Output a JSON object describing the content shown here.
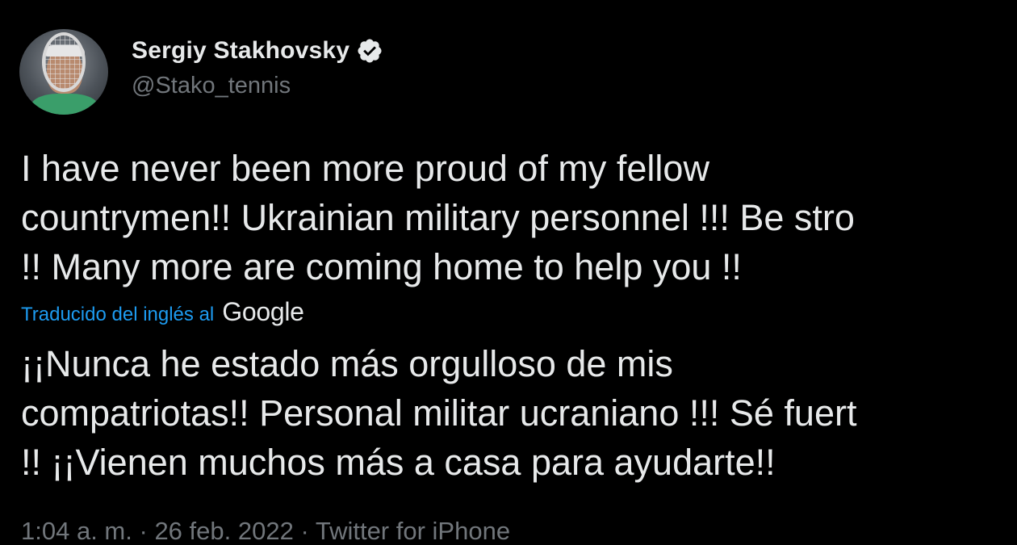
{
  "author": {
    "display_name": "Sergiy Stakhovsky",
    "handle": "@Stako_tennis",
    "verified": true,
    "avatar_icon": "profile-photo-tennis-player"
  },
  "tweet": {
    "original_lines": [
      "I have never been more proud of my fellow",
      "countrymen!! Ukrainian military personnel !!! Be stro",
      "!! Many more are coming home to help you !!"
    ],
    "translation_label": "Traducido del inglés al",
    "translation_provider": "Google",
    "translated_lines": [
      "¡¡Nunca he estado más orgulloso de mis",
      "compatriotas!! Personal militar ucraniano !!! Sé fuert",
      "!! ¡¡Vienen muchos más a casa para ayudarte!!"
    ],
    "time": "1:04 a. m.",
    "date": "26 feb. 2022",
    "source": "Twitter for iPhone",
    "separator": "·"
  },
  "colors": {
    "background": "#000000",
    "primary_text": "#e7e9ea",
    "secondary_text": "#71767b",
    "link_blue": "#1d9bf0"
  }
}
